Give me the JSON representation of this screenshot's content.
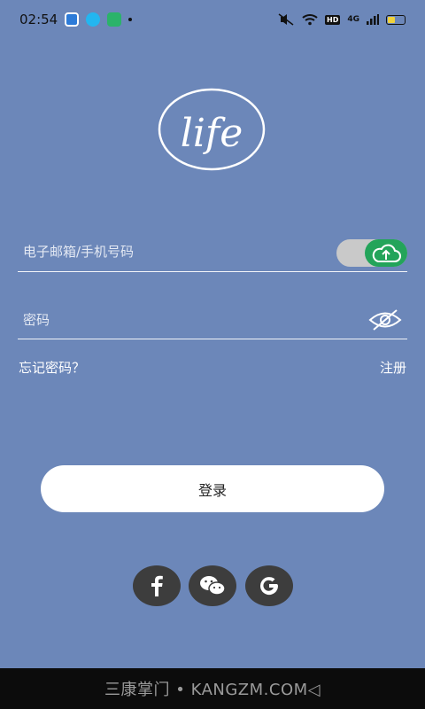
{
  "status_bar": {
    "time": "02:54",
    "network": "4G"
  },
  "form": {
    "email_placeholder": "电子邮箱/手机号码",
    "password_placeholder": "密码",
    "forgot_label": "忘记密码？",
    "register_label": "注册",
    "login_label": "登录"
  },
  "logo_text": "life",
  "watermark": "三康掌门 • KANGZM.COM◁",
  "colors": {
    "background": "#6c87b9",
    "toggle_green": "#23a45a",
    "social_bg": "#3d3d3d"
  },
  "icons": [
    "eye-slash-icon",
    "cloud-upload-icon",
    "facebook-icon",
    "wechat-icon",
    "google-icon"
  ]
}
